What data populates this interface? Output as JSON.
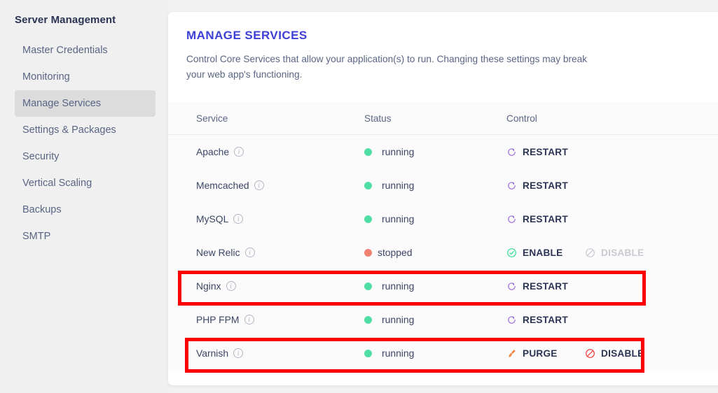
{
  "sidebar": {
    "title": "Server Management",
    "items": [
      {
        "label": "Master Credentials",
        "active": false
      },
      {
        "label": "Monitoring",
        "active": false
      },
      {
        "label": "Manage Services",
        "active": true
      },
      {
        "label": "Settings & Packages",
        "active": false
      },
      {
        "label": "Security",
        "active": false
      },
      {
        "label": "Vertical Scaling",
        "active": false
      },
      {
        "label": "Backups",
        "active": false
      },
      {
        "label": "SMTP",
        "active": false
      }
    ]
  },
  "card": {
    "title": "MANAGE SERVICES",
    "description": "Control Core Services that allow your application(s) to run. Changing these settings may break your web app's functioning.",
    "title_color": "#3d3fd6"
  },
  "table": {
    "headers": {
      "service": "Service",
      "status": "Status",
      "control": "Control"
    },
    "rows": [
      {
        "service": "Apache",
        "info_icon": "info-icon",
        "status": "running",
        "status_color": "#4fdfa4",
        "controls": [
          {
            "label": "RESTART",
            "icon": "restart-icon",
            "icon_color": "#a06fe0",
            "enabled": true
          }
        ],
        "highlighted": false
      },
      {
        "service": "Memcached",
        "info_icon": "info-icon",
        "status": "running",
        "status_color": "#4fdfa4",
        "controls": [
          {
            "label": "RESTART",
            "icon": "restart-icon",
            "icon_color": "#a06fe0",
            "enabled": true
          }
        ],
        "highlighted": false
      },
      {
        "service": "MySQL",
        "info_icon": "info-icon",
        "status": "running",
        "status_color": "#4fdfa4",
        "controls": [
          {
            "label": "RESTART",
            "icon": "restart-icon",
            "icon_color": "#a06fe0",
            "enabled": true
          }
        ],
        "highlighted": false
      },
      {
        "service": "New Relic",
        "info_icon": "info-icon",
        "status": "stopped",
        "status_color": "#f08071",
        "controls": [
          {
            "label": "ENABLE",
            "icon": "check-circle-icon",
            "icon_color": "#3ddc9b",
            "enabled": true
          },
          {
            "label": "DISABLE",
            "icon": "block-circle-icon",
            "icon_color": "#c9cbd3",
            "enabled": false
          }
        ],
        "highlighted": false
      },
      {
        "service": "Nginx",
        "info_icon": "info-icon",
        "status": "running",
        "status_color": "#4fdfa4",
        "controls": [
          {
            "label": "RESTART",
            "icon": "restart-icon",
            "icon_color": "#a06fe0",
            "enabled": true
          }
        ],
        "highlighted": true
      },
      {
        "service": "PHP FPM",
        "info_icon": "info-icon",
        "status": "running",
        "status_color": "#4fdfa4",
        "controls": [
          {
            "label": "RESTART",
            "icon": "restart-icon",
            "icon_color": "#a06fe0",
            "enabled": true
          }
        ],
        "highlighted": false
      },
      {
        "service": "Varnish",
        "info_icon": "info-icon",
        "status": "running",
        "status_color": "#4fdfa4",
        "controls": [
          {
            "label": "PURGE",
            "icon": "brush-icon",
            "icon_color": "#f0803c",
            "enabled": true
          },
          {
            "label": "DISABLE",
            "icon": "block-circle-icon",
            "icon_color": "#f23a3a",
            "enabled": true
          }
        ],
        "highlighted": false
      }
    ]
  },
  "highlight": {
    "color": "#fb0000",
    "targets": [
      "Nginx",
      "Varnish"
    ]
  },
  "info_glyph": "i"
}
